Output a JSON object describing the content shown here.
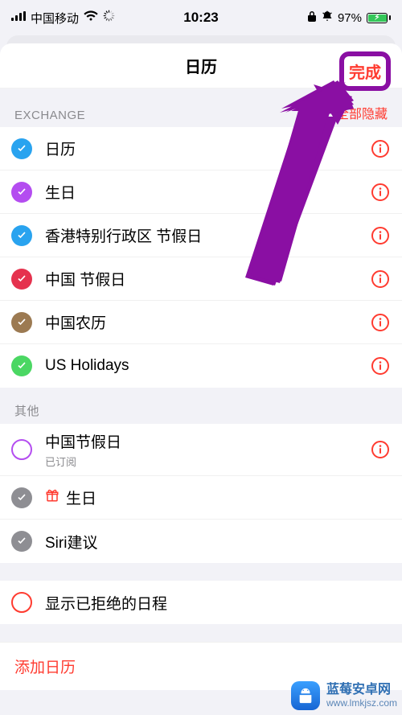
{
  "statusbar": {
    "carrier": "中国移动",
    "time": "10:23",
    "battery_pct": "97%"
  },
  "nav": {
    "title": "日历",
    "done": "完成"
  },
  "sections": {
    "exchange": {
      "title": "EXCHANGE",
      "hide_all": "全部隐藏",
      "items": [
        {
          "label": "日历",
          "color": "#29a3ef",
          "checked": true
        },
        {
          "label": "生日",
          "color": "#b44df0",
          "checked": true
        },
        {
          "label": "香港特别行政区 节假日",
          "color": "#29a3ef",
          "checked": true
        },
        {
          "label": "中国 节假日",
          "color": "#e5324e",
          "checked": true
        },
        {
          "label": "中国农历",
          "color": "#9c7a52",
          "checked": true
        },
        {
          "label": "US Holidays",
          "color": "#4bd763",
          "checked": true
        }
      ]
    },
    "other": {
      "title": "其他",
      "items": [
        {
          "label": "中国节假日",
          "sub": "已订阅",
          "color": "#b44df0",
          "checked": false,
          "ring": true,
          "info": true
        },
        {
          "label": "生日",
          "color": "#8e8e93",
          "checked": true,
          "gift": true,
          "gift_color": "#ff3b30",
          "info": false
        },
        {
          "label": "Siri建议",
          "color": "#8e8e93",
          "checked": true,
          "info": false
        }
      ]
    },
    "rejected": {
      "label": "显示已拒绝的日程",
      "color": "#ff3b30"
    }
  },
  "footer": {
    "add_calendar": "添加日历"
  },
  "watermark": {
    "title": "蓝莓安卓网",
    "url": "www.lmkjsz.com"
  },
  "colors": {
    "accent_red": "#ff3b30",
    "info_red": "#ff3b30",
    "highlight_purple": "#8a0fa3"
  }
}
